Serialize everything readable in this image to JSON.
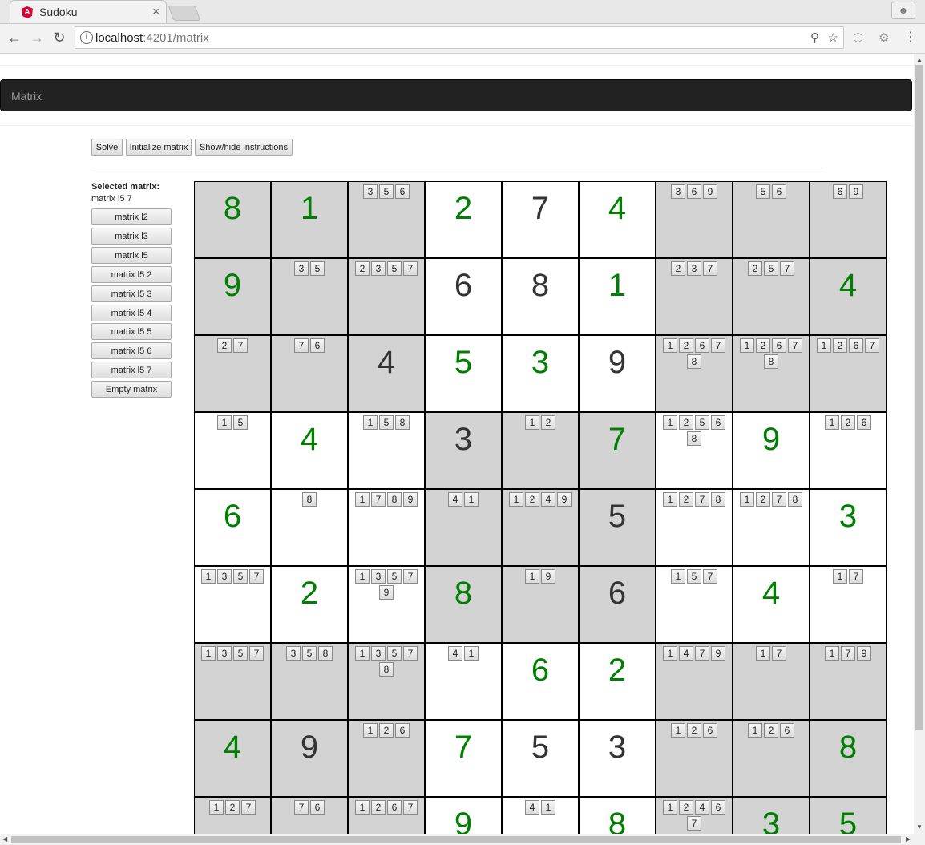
{
  "browser": {
    "tab_title": "Sudoku",
    "tab_close": "×",
    "url_host": "localhost",
    "url_path": ":4201/matrix",
    "icons": {
      "back": "back-arrow-icon",
      "forward": "forward-arrow-icon",
      "reload": "reload-icon",
      "zoom": "zoom-out-icon",
      "star": "star-icon",
      "menu": "menu-icon"
    }
  },
  "navbar": {
    "brand": "Matrix"
  },
  "toolbar": {
    "solve": "Solve",
    "initialize": "Initialize matrix",
    "instructions": "Show/hide instructions"
  },
  "sidebar": {
    "selected_label": "Selected matrix:",
    "selected_value": "matrix l5 7",
    "matrices": [
      "matrix l2",
      "matrix l3",
      "matrix l5",
      "matrix l5 2",
      "matrix l5 3",
      "matrix l5 4",
      "matrix l5 5",
      "matrix l5 6",
      "matrix l5 7",
      "Empty matrix"
    ]
  },
  "colors": {
    "given": "#333333",
    "solved": "#008000",
    "shaded_box": "#d3d3d3"
  },
  "board": [
    [
      {
        "v": "8",
        "c": "green"
      },
      {
        "v": "1",
        "c": "green"
      },
      {
        "cands": [
          "3",
          "5",
          "6"
        ]
      },
      {
        "v": "2",
        "c": "green"
      },
      {
        "v": "7",
        "c": "dark"
      },
      {
        "v": "4",
        "c": "green"
      },
      {
        "cands": [
          "3",
          "6",
          "9"
        ]
      },
      {
        "cands": [
          "5",
          "6"
        ]
      },
      {
        "cands": [
          "6",
          "9"
        ]
      }
    ],
    [
      {
        "v": "9",
        "c": "green"
      },
      {
        "cands": [
          "3",
          "5"
        ]
      },
      {
        "cands": [
          "2",
          "3",
          "5",
          "7"
        ]
      },
      {
        "v": "6",
        "c": "dark"
      },
      {
        "v": "8",
        "c": "dark"
      },
      {
        "v": "1",
        "c": "green"
      },
      {
        "cands": [
          "2",
          "3",
          "7"
        ]
      },
      {
        "cands": [
          "2",
          "5",
          "7"
        ]
      },
      {
        "v": "4",
        "c": "green"
      }
    ],
    [
      {
        "cands": [
          "2",
          "7"
        ]
      },
      {
        "cands": [
          "7",
          "6"
        ]
      },
      {
        "v": "4",
        "c": "dark"
      },
      {
        "v": "5",
        "c": "green"
      },
      {
        "v": "3",
        "c": "green"
      },
      {
        "v": "9",
        "c": "dark"
      },
      {
        "cands": [
          "1",
          "2",
          "6",
          "7",
          "8"
        ]
      },
      {
        "cands": [
          "1",
          "2",
          "6",
          "7",
          "8"
        ]
      },
      {
        "cands": [
          "1",
          "2",
          "6",
          "7"
        ]
      }
    ],
    [
      {
        "cands": [
          "1",
          "5"
        ]
      },
      {
        "v": "4",
        "c": "green"
      },
      {
        "cands": [
          "1",
          "5",
          "8"
        ]
      },
      {
        "v": "3",
        "c": "dark"
      },
      {
        "cands": [
          "1",
          "2"
        ]
      },
      {
        "v": "7",
        "c": "green"
      },
      {
        "cands": [
          "1",
          "2",
          "5",
          "6",
          "8"
        ]
      },
      {
        "v": "9",
        "c": "green"
      },
      {
        "cands": [
          "1",
          "2",
          "6"
        ]
      }
    ],
    [
      {
        "v": "6",
        "c": "green"
      },
      {
        "cands": [
          "8"
        ]
      },
      {
        "cands": [
          "1",
          "7",
          "8",
          "9"
        ]
      },
      {
        "cands": [
          "4",
          "1"
        ]
      },
      {
        "cands": [
          "1",
          "2",
          "4",
          "9"
        ]
      },
      {
        "v": "5",
        "c": "dark"
      },
      {
        "cands": [
          "1",
          "2",
          "7",
          "8"
        ]
      },
      {
        "cands": [
          "1",
          "2",
          "7",
          "8"
        ]
      },
      {
        "v": "3",
        "c": "green"
      }
    ],
    [
      {
        "cands": [
          "1",
          "3",
          "5",
          "7"
        ]
      },
      {
        "v": "2",
        "c": "green"
      },
      {
        "cands": [
          "1",
          "3",
          "5",
          "7",
          "9"
        ]
      },
      {
        "v": "8",
        "c": "green"
      },
      {
        "cands": [
          "1",
          "9"
        ]
      },
      {
        "v": "6",
        "c": "dark"
      },
      {
        "cands": [
          "1",
          "5",
          "7"
        ]
      },
      {
        "v": "4",
        "c": "green"
      },
      {
        "cands": [
          "1",
          "7"
        ]
      }
    ],
    [
      {
        "cands": [
          "1",
          "3",
          "5",
          "7"
        ]
      },
      {
        "cands": [
          "3",
          "5",
          "8"
        ]
      },
      {
        "cands": [
          "1",
          "3",
          "5",
          "7",
          "8"
        ]
      },
      {
        "cands": [
          "4",
          "1"
        ]
      },
      {
        "v": "6",
        "c": "green"
      },
      {
        "v": "2",
        "c": "green"
      },
      {
        "cands": [
          "1",
          "4",
          "7",
          "9"
        ]
      },
      {
        "cands": [
          "1",
          "7"
        ]
      },
      {
        "cands": [
          "1",
          "7",
          "9"
        ]
      }
    ],
    [
      {
        "v": "4",
        "c": "green"
      },
      {
        "v": "9",
        "c": "dark"
      },
      {
        "cands": [
          "1",
          "2",
          "6"
        ]
      },
      {
        "v": "7",
        "c": "green"
      },
      {
        "v": "5",
        "c": "dark"
      },
      {
        "v": "3",
        "c": "dark"
      },
      {
        "cands": [
          "1",
          "2",
          "6"
        ]
      },
      {
        "cands": [
          "1",
          "2",
          "6"
        ]
      },
      {
        "v": "8",
        "c": "green"
      }
    ],
    [
      {
        "cands": [
          "1",
          "2",
          "7"
        ]
      },
      {
        "cands": [
          "7",
          "6"
        ]
      },
      {
        "cands": [
          "1",
          "2",
          "6",
          "7"
        ]
      },
      {
        "v": "9",
        "c": "green"
      },
      {
        "cands": [
          "4",
          "1"
        ]
      },
      {
        "v": "8",
        "c": "green"
      },
      {
        "cands": [
          "1",
          "2",
          "4",
          "6",
          "7"
        ]
      },
      {
        "v": "3",
        "c": "green"
      },
      {
        "v": "5",
        "c": "green"
      }
    ]
  ]
}
